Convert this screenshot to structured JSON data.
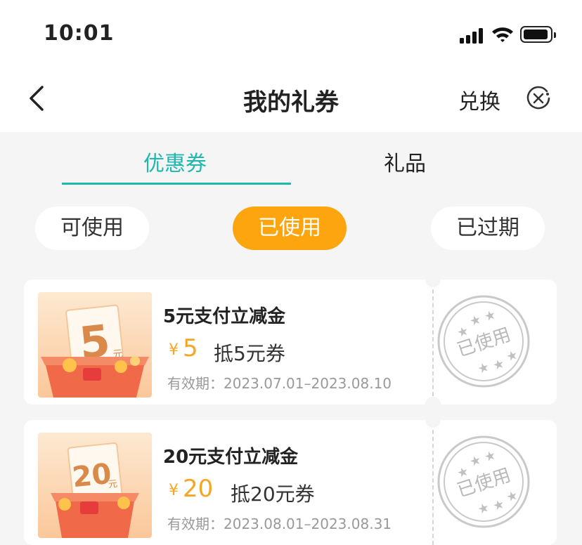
{
  "status_bar": {
    "time": "10:01"
  },
  "header": {
    "title": "我的礼券",
    "exchange_label": "兑换"
  },
  "tabs": [
    {
      "label": "优惠券",
      "active": true
    },
    {
      "label": "礼品",
      "active": false
    }
  ],
  "filters": [
    {
      "label": "可使用",
      "active": false
    },
    {
      "label": "已使用",
      "active": true
    },
    {
      "label": "已过期",
      "active": false
    }
  ],
  "coupons": [
    {
      "thumb_text": "5",
      "thumb_unit": "元",
      "title": "5元支付立减金",
      "yen": "¥",
      "amount": "5",
      "desc": "抵5元券",
      "validity": "有效期：2023.07.01–2023.08.10",
      "stamp": "已使用"
    },
    {
      "thumb_text": "20",
      "thumb_unit": "元",
      "title": "20元支付立减金",
      "yen": "¥",
      "amount": "20",
      "desc": "抵20元券",
      "validity": "有效期：2023.08.01–2023.08.31",
      "stamp": "已使用"
    }
  ],
  "colors": {
    "accent_teal": "#1fb8ad",
    "accent_orange": "#fda50f",
    "amount_orange": "#f5a623"
  }
}
